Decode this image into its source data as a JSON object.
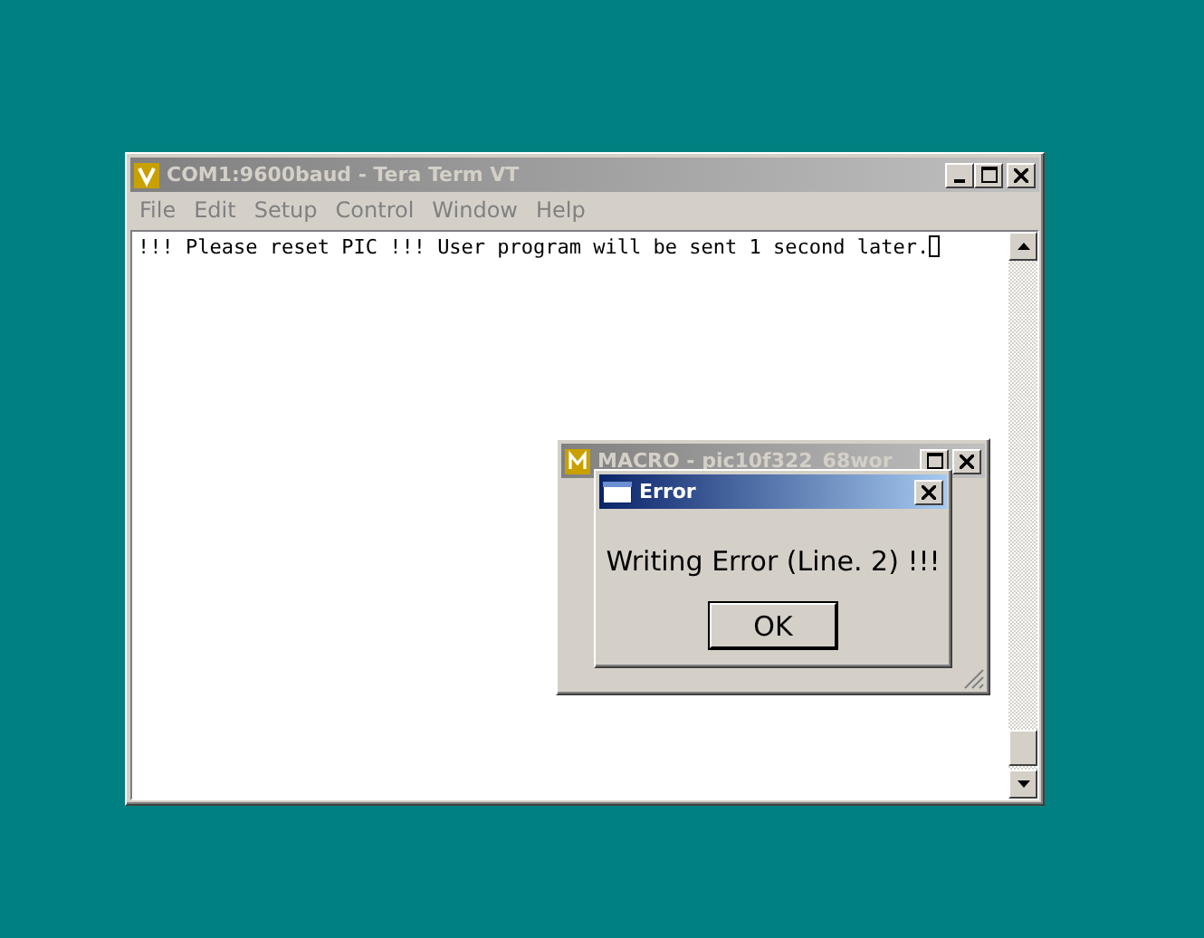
{
  "main_window": {
    "title": "COM1:9600baud - Tera Term VT",
    "menu": [
      "File",
      "Edit",
      "Setup",
      "Control",
      "Window",
      "Help"
    ],
    "terminal_text": "!!! Please reset PIC !!!  User program will be sent 1 second later."
  },
  "macro_window": {
    "title": "MACRO - pic10f322_68wor"
  },
  "error_dialog": {
    "title": "Error",
    "message": "Writing Error (Line. 2) !!!",
    "button": "OK"
  }
}
